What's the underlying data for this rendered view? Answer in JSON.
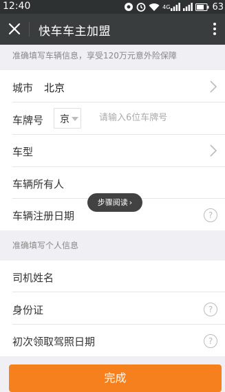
{
  "status_bar": {
    "time": "12:40",
    "network": "4G",
    "battery": "63"
  },
  "nav": {
    "title": "快车车主加盟"
  },
  "vehicle_section": {
    "header": "准确填写车辆信息，享受120万元意外险保障"
  },
  "vehicle_rows": {
    "city": {
      "label": "城市",
      "value": "北京"
    },
    "plate": {
      "label": "车牌号",
      "province": "京",
      "placeholder": "请输入6位车牌号"
    },
    "model": {
      "label": "车型"
    },
    "owner": {
      "label": "车辆所有人"
    },
    "reg_date": {
      "label": "车辆注册日期"
    }
  },
  "personal_section": {
    "header": "准确填写个人信息"
  },
  "personal_rows": {
    "name": {
      "label": "司机姓名"
    },
    "id_card": {
      "label": "身份证"
    },
    "license_date": {
      "label": "初次领取驾照日期"
    }
  },
  "toast": {
    "text": "步骤阅读"
  },
  "submit": {
    "label": "完成"
  },
  "colors": {
    "accent": "#f7801e",
    "navbar": "#3a3d3e",
    "statusbar": "#2e3132"
  }
}
